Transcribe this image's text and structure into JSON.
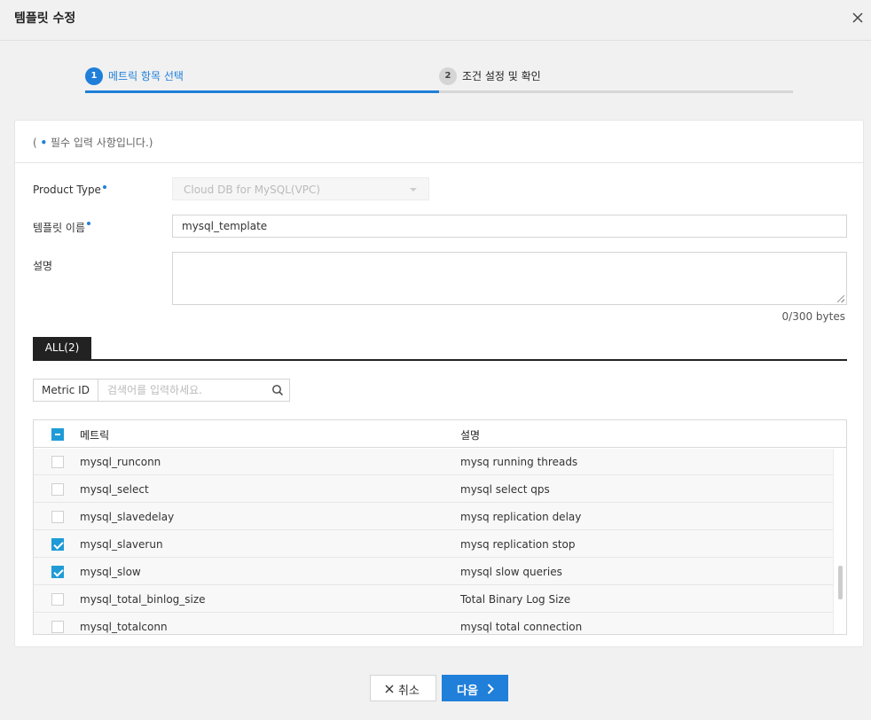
{
  "dialog": {
    "title": "템플릿 수정"
  },
  "stepper": {
    "steps": [
      {
        "num": "1",
        "label": "메트릭 항목 선택"
      },
      {
        "num": "2",
        "label": "조건 설정 및 확인"
      }
    ]
  },
  "form": {
    "required_note_open": "( ",
    "required_note_dot": "•",
    "required_note_text": " 필수 입력 사항입니다.)",
    "product_type_label": "Product Type",
    "product_type_value": "Cloud DB for MySQL(VPC)",
    "template_name_label": "템플릿 이름",
    "template_name_value": "mysql_template",
    "description_label": "설명",
    "description_value": "",
    "byte_count": "0/300 bytes"
  },
  "tabs": [
    {
      "label": "ALL(2)"
    }
  ],
  "search": {
    "prefix": "Metric ID",
    "placeholder": "검색어를 입력하세요."
  },
  "grid": {
    "headers": {
      "metric": "메트릭",
      "description": "설명"
    },
    "rows": [
      {
        "metric": "mysql_runconn",
        "description": "mysq running threads",
        "checked": false
      },
      {
        "metric": "mysql_select",
        "description": "mysql select qps",
        "checked": false
      },
      {
        "metric": "mysql_slavedelay",
        "description": "mysq replication delay",
        "checked": false
      },
      {
        "metric": "mysql_slaverun",
        "description": "mysq replication stop",
        "checked": true
      },
      {
        "metric": "mysql_slow",
        "description": "mysql slow queries",
        "checked": true
      },
      {
        "metric": "mysql_total_binlog_size",
        "description": "Total Binary Log Size",
        "checked": false
      },
      {
        "metric": "mysql_totalconn",
        "description": "mysql total connection",
        "checked": false
      }
    ]
  },
  "footer": {
    "cancel_label": "취소",
    "next_label": "다음"
  },
  "colors": {
    "accent": "#1f7fd9",
    "checkbox": "#1f9bd7"
  }
}
